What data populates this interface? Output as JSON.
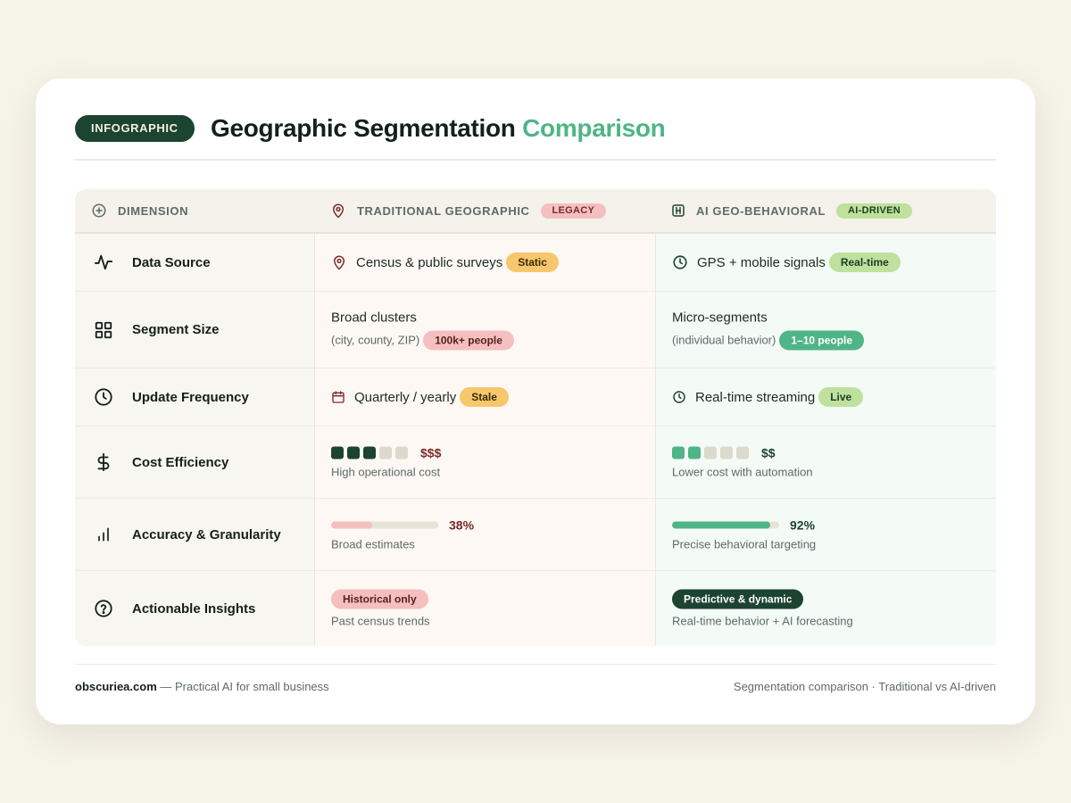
{
  "header": {
    "pill": "INFOGRAPHIC",
    "title_main": "Geographic Segmentation",
    "title_accent": "Comparison"
  },
  "columns": {
    "dimension": "DIMENSION",
    "traditional": "TRADITIONAL GEOGRAPHIC",
    "traditional_tag": "LEGACY",
    "ai": "AI GEO-BEHAVIORAL",
    "ai_tag": "AI-DRIVEN"
  },
  "rows": [
    {
      "label": "Data Source",
      "icon": "activity-icon",
      "trad": {
        "text": "Census & public surveys",
        "badge": "Static",
        "icon": "map-pin-icon"
      },
      "ai": {
        "text": "GPS + mobile signals",
        "badge": "Real-time",
        "icon": "clock-icon"
      }
    },
    {
      "label": "Segment Size",
      "icon": "grid-icon",
      "trad": {
        "text": "Broad clusters",
        "sub": "(city, county, ZIP)",
        "badge": "100k+ people"
      },
      "ai": {
        "text": "Micro-segments",
        "sub": "(individual behavior)",
        "badge": "1–10 people"
      }
    },
    {
      "label": "Update Frequency",
      "icon": "clock-icon",
      "trad": {
        "text": "Quarterly / yearly",
        "badge": "Stale",
        "icon": "calendar-icon"
      },
      "ai": {
        "text": "Real-time streaming",
        "badge": "Live",
        "icon": "clock-icon"
      }
    },
    {
      "label": "Cost Efficiency",
      "icon": "dollar-icon",
      "trad": {
        "level": 3,
        "max": 5,
        "value": "$$$",
        "sub": "High operational cost"
      },
      "ai": {
        "level": 2,
        "max": 5,
        "value": "$$",
        "sub": "Lower cost with automation"
      }
    },
    {
      "label": "Accuracy & Granularity",
      "icon": "bar-chart-icon",
      "trad": {
        "percent": 38,
        "value": "38%",
        "sub": "Broad estimates"
      },
      "ai": {
        "percent": 92,
        "value": "92%",
        "sub": "Precise behavioral targeting"
      }
    },
    {
      "label": "Actionable Insights",
      "icon": "help-circle-icon",
      "trad": {
        "badge": "Historical only",
        "sub": "Past census trends"
      },
      "ai": {
        "badge": "Predictive & dynamic",
        "sub": "Real-time behavior + AI forecasting"
      }
    }
  ],
  "footer": {
    "brand": "obscuriea.com",
    "tagline": " — Practical AI for small business",
    "right": "Segmentation comparison · Traditional vs AI-driven"
  },
  "colors": {
    "dark_green": "#1d4331",
    "accent_green": "#4fb586",
    "maroon": "#7b2a2a",
    "pink": "#f4bfbf",
    "yellow": "#f7c76d",
    "lime": "#bfe19d"
  }
}
